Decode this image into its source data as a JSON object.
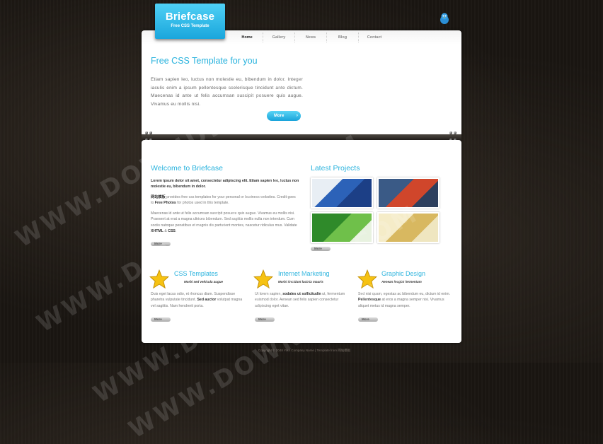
{
  "logo": {
    "title": "Briefcase",
    "subtitle": "Free CSS Template"
  },
  "nav": {
    "items": [
      "Home",
      "Gallery",
      "News",
      "Blog",
      "Contact"
    ],
    "active": "Home"
  },
  "hero": {
    "title": "Free CSS Template for you",
    "text": "Etiam sapien leo, luctus non molestie eu, bibendum in dolor. Integer iaculis enim a ipsum pellentesque scelerisque tincidunt ante dictum. Maecenas id ante ut felis accumsan suscipit posuere quis augue. Vivamus eu mollis nisi.",
    "more_label": "More"
  },
  "welcome": {
    "title": "Welcome to Briefcase",
    "lead": "Lorem ipsum dolor sit amet, consectetur adipiscing elit. Etiam sapien leo, luctus non molestie eu, bibendum in dolor.",
    "p2_link": "网站模板",
    "p2_text": " provides free css templates for your personal or business websites. Credit goes to ",
    "p2_bold": "Free Photos",
    "p2_end": " for photos used in this template.",
    "p3": "Maecenas id ante ut felis accumsan suscipit posuere quis augue. Vivamus eu mollis nisi. Praesent at erat a magna ultrices bibendum. Sed sagittis mollis nulla non interdum. Cum sociis natoque penatibus et magnis dis parturient montes, nascetur ridiculus mus. Validate ",
    "p3_b1": "XHTML",
    "p3_and": " & ",
    "p3_b2": "CSS",
    "p3_end": ".",
    "more_label": "More"
  },
  "projects": {
    "title": "Latest Projects",
    "more_label": "More"
  },
  "features": [
    {
      "title": "CSS Templates",
      "subtitle": "Morbi sed vehicula augue",
      "text": "Duis eget lacus odio, et rhoncus diam. Suspendisse pharetra vulputate tincidunt. ",
      "bold": "Sed auctor",
      "text2": " volutpat magna vel sagittis. Nam hendrerit porta.",
      "more_label": "More"
    },
    {
      "title": "Internet Marketing",
      "subtitle": "Morbi tincidunt lacinia mauris",
      "text": "Ut lorem sapien, ",
      "bold": "sodales ut sollicitudin",
      "text2": " ut, fermentum euismod dolor. Aenean sed felis sapien consectetur adipiscing eget vitae.",
      "more_label": "More"
    },
    {
      "title": "Graphic Design",
      "subtitle": "Aenean feugiat fermentum",
      "text": "Sed nisi quam, egestas ac bibendum eu, dictum id enim. ",
      "bold": "Pellentesque",
      "text2": " at eros a magna semper nisi. Vivamus aliquet metus id magna semper.",
      "more_label": "More"
    }
  ],
  "footer": {
    "text": "Copyright © 2048 Your Company Name | Template from 网站模板"
  },
  "watermark": {
    "text": "WWW.DOWNDEMO.COM"
  },
  "colors": {
    "accent": "#27b2dd",
    "button": "#1aa6dc",
    "background": "#1a1612"
  }
}
